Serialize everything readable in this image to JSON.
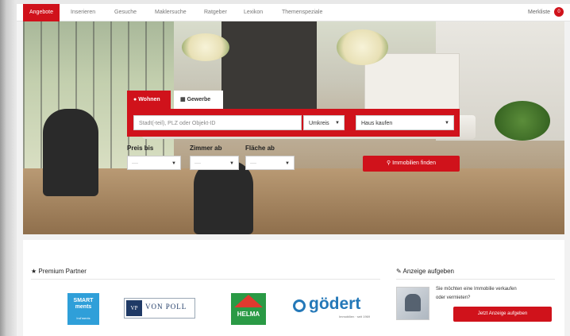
{
  "nav": {
    "items": [
      "Angebote",
      "Inserieren",
      "Gesuche",
      "Maklersuche",
      "Ratgeber",
      "Lexikon",
      "Themenspeziale"
    ],
    "merkliste_label": "Merkliste",
    "merkliste_count": "0"
  },
  "search": {
    "tabs": {
      "wohnen": "Wohnen",
      "gewerbe": "Gewerbe"
    },
    "location_placeholder": "Stadt(-teil), PLZ oder Objekt-ID",
    "radius_label": "Umkreis",
    "type_value": "Haus kaufen",
    "preis_label": "Preis bis",
    "zimmer_label": "Zimmer ab",
    "flaeche_label": "Fläche ab",
    "select_placeholder": "----",
    "find_button": "Immobilien finden"
  },
  "partners": {
    "title": "Premium Partner",
    "smart_line1": "SMART",
    "smart_line2": "ments",
    "smart_small": "Ind'ments",
    "vonpoll_mark": "VP",
    "vonpoll_name": "VON POLL",
    "helma_name": "HELMA",
    "godert_name": "gödert",
    "godert_sub": "Immobilien · seit 1969"
  },
  "ad": {
    "title": "Anzeige aufgeben",
    "text": "Sie möchten eine Immobilie verkaufen oder vermieten?",
    "button": "Jetzt Anzeige aufgeben"
  },
  "colors": {
    "accent": "#d0121b",
    "helma": "#2a9a45",
    "godert": "#2478b8",
    "smart": "#2f9fd9"
  }
}
